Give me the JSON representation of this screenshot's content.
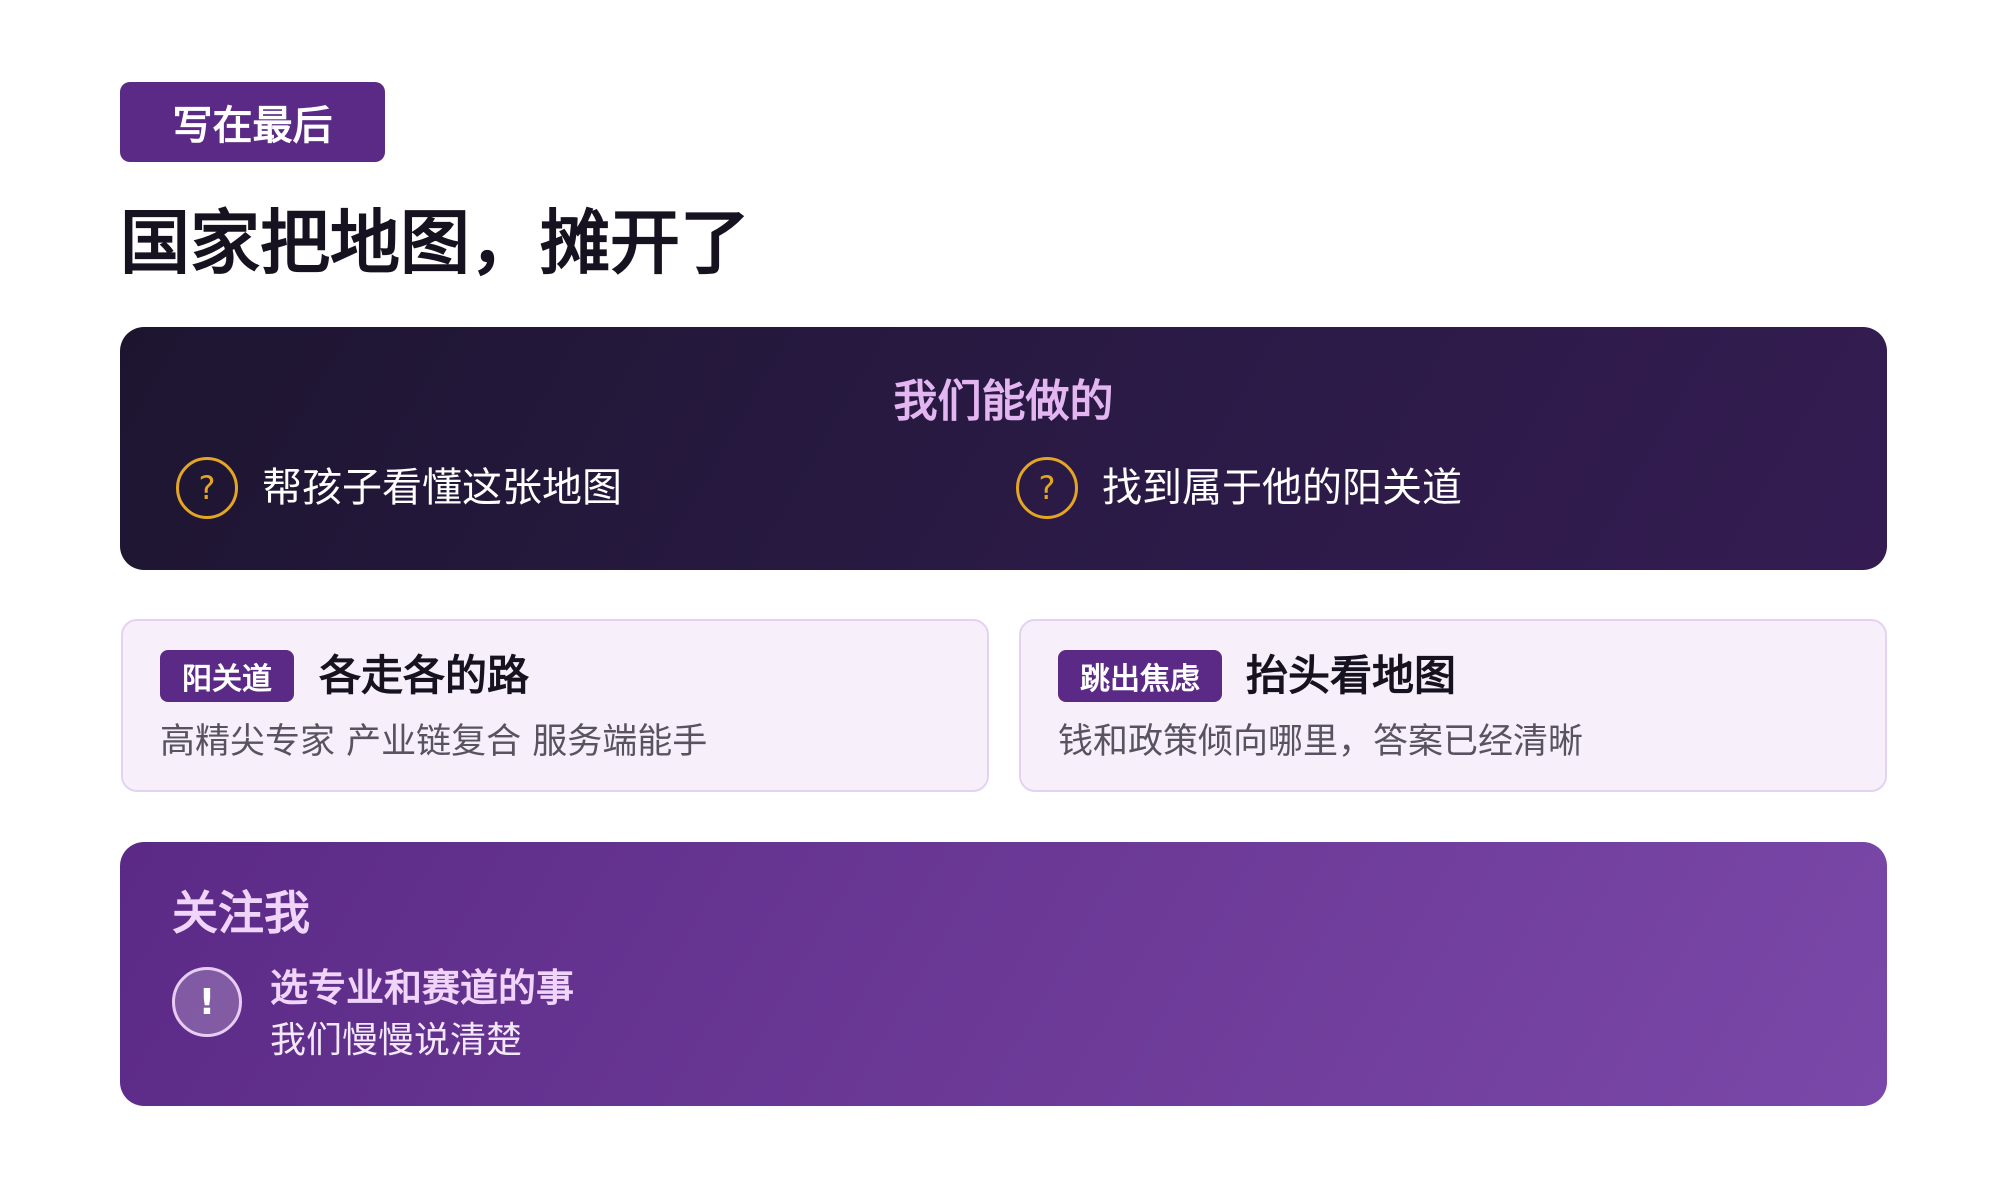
{
  "header": {
    "tag": "写在最后",
    "title": "国家把地图，摊开了"
  },
  "what_we_do": {
    "title": "我们能做的",
    "items": [
      {
        "icon": "question-circle-icon",
        "glyph": "?",
        "text": "帮孩子看懂这张地图"
      },
      {
        "icon": "question-circle-icon",
        "glyph": "?",
        "text": "找到属于他的阳关道"
      }
    ]
  },
  "cards": [
    {
      "badge": "阳关道",
      "title": "各走各的路",
      "subtitle": "高精尖专家 产业链复合 服务端能手"
    },
    {
      "badge": "跳出焦虑",
      "title": "抬头看地图",
      "subtitle": "钱和政策倾向哪里，答案已经清晰"
    }
  ],
  "follow": {
    "title": "关注我",
    "icon": "exclamation-circle-icon",
    "glyph": "!",
    "line1": "选专业和赛道的事",
    "line2": "我们慢慢说清楚"
  },
  "colors": {
    "primary_purple": "#5b2a86",
    "dark_panel": "#1d1530",
    "accent_gold": "#e3a524",
    "accent_pink": "#e3b6f2",
    "card_bg": "#f7f0fb"
  }
}
